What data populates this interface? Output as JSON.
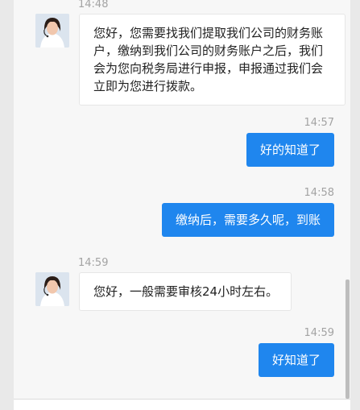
{
  "messages": [
    {
      "direction": "incoming",
      "time": "14:48",
      "text": "您好，您需要找我们提取我们公司的财务账户，缴纳到我们公司的财务账户之后，我们会为您向税务局进行申报，申报通过我们会立即为您进行拨款。"
    },
    {
      "direction": "outgoing",
      "time": "14:57",
      "text": "好的知道了"
    },
    {
      "direction": "outgoing",
      "time": "14:58",
      "text": "缴纳后，需要多久呢，到账"
    },
    {
      "direction": "incoming",
      "time": "14:59",
      "text": "您好，一般需要审核24小时左右。"
    },
    {
      "direction": "outgoing",
      "time": "14:59",
      "text": "好知道了"
    }
  ],
  "colors": {
    "outgoing_bubble": "#1f86ee",
    "incoming_bubble": "#ffffff",
    "background": "#f7f7f7"
  }
}
